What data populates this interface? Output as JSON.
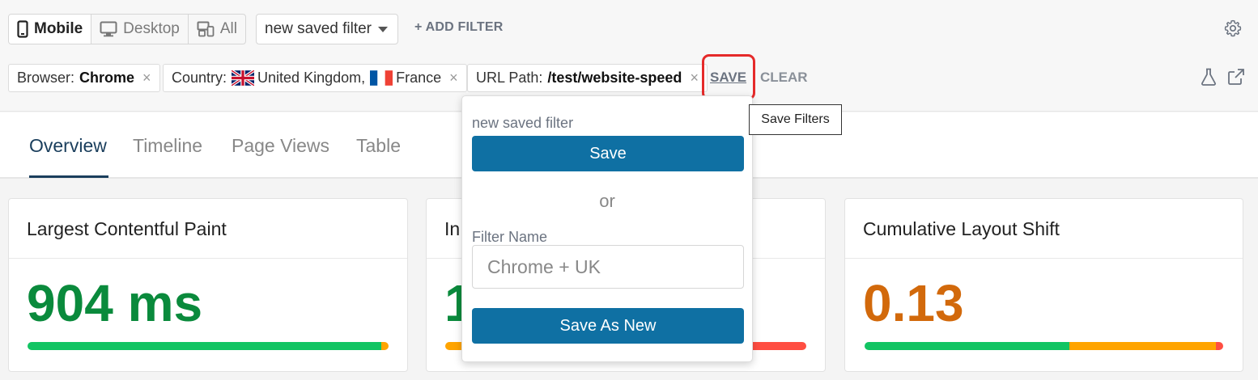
{
  "toolbar": {
    "device_tabs": [
      {
        "label": "Mobile",
        "active": true,
        "icon": "mobile-icon"
      },
      {
        "label": "Desktop",
        "active": false,
        "icon": "desktop-icon"
      },
      {
        "label": "All",
        "active": false,
        "icon": "devices-icon"
      }
    ],
    "saved_filter_select": "new saved filter",
    "add_filter_label": "+ ADD FILTER",
    "settings_icon": "gear-icon"
  },
  "filters": {
    "browser": {
      "key": "Browser:",
      "value": "Chrome"
    },
    "country": {
      "key": "Country:",
      "value1": "United Kingdom,",
      "value2": "France"
    },
    "url_path": {
      "key": "URL Path:",
      "value": "/test/website-speed"
    },
    "remove_symbol": "×",
    "save_label": "SAVE",
    "clear_label": "CLEAR",
    "save_tooltip": "Save Filters"
  },
  "tabs": [
    "Overview",
    "Timeline",
    "Page Views",
    "Table"
  ],
  "active_tab": "Overview",
  "cards": [
    {
      "title": "Largest Contentful Paint",
      "value": "904 ms",
      "color": "#0a8a3c",
      "distribution": [
        0.98,
        0.02,
        0.0
      ]
    },
    {
      "title": "In",
      "value": "1",
      "color": "#0a8a3c",
      "distribution": [
        0.0,
        0.85,
        0.15
      ]
    },
    {
      "title": "Cumulative Layout Shift",
      "value": "0.13",
      "color": "#d2690b",
      "distribution": [
        0.57,
        0.41,
        0.02
      ]
    }
  ],
  "colors": {
    "good": "#12c463",
    "needs_improvement": "#ffa400",
    "poor": "#ff4e42",
    "accent": "#0f70a3"
  },
  "save_popup": {
    "current_name": "new saved filter",
    "save_button": "Save",
    "or_text": "or",
    "name_label": "Filter Name",
    "name_placeholder": "Chrome + UK",
    "save_as_new_button": "Save As New"
  }
}
